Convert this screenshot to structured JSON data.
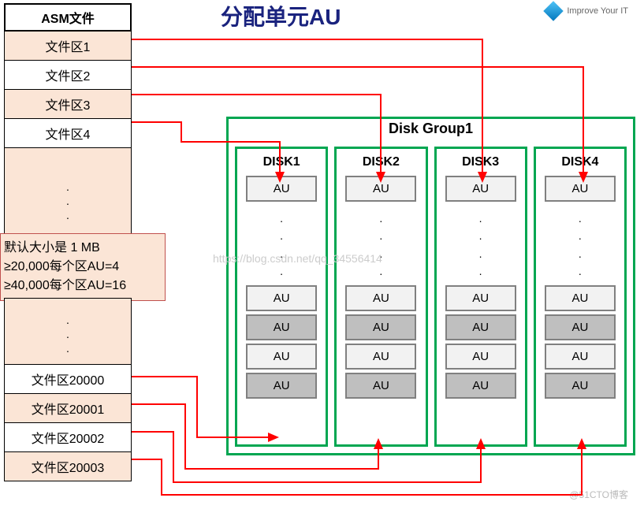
{
  "title": "分配单元AU",
  "logo_text": "Improve Your IT",
  "asm": {
    "header": "ASM文件",
    "cells": [
      {
        "label": "文件区1",
        "white": false
      },
      {
        "label": "文件区2",
        "white": true
      },
      {
        "label": "文件区3",
        "white": false
      },
      {
        "label": "文件区4",
        "white": true
      }
    ],
    "bottom_cells": [
      {
        "label": "文件区20000",
        "white": true
      },
      {
        "label": "文件区20001",
        "white": false
      },
      {
        "label": "文件区20002",
        "white": true
      },
      {
        "label": "文件区20003",
        "white": false
      }
    ]
  },
  "note": {
    "line1": "默认大小是 1 MB",
    "line2": "≥20,000每个区AU=4",
    "line3": "≥40,000每个区AU=16"
  },
  "disk_group": {
    "title": "Disk Group1",
    "disks": [
      {
        "name": "DISK1"
      },
      {
        "name": "DISK2"
      },
      {
        "name": "DISK3"
      },
      {
        "name": "DISK4"
      }
    ],
    "au_label": "AU"
  },
  "watermark": "https://blog.csdn.net/qq_34556414",
  "watermark2": "@51CTO博客",
  "chart_data": {
    "type": "diagram",
    "description": "ASM file extent to AU allocation mapping",
    "mappings": [
      {
        "extent": "文件区1",
        "target_disk": "DISK3",
        "au_index": 0
      },
      {
        "extent": "文件区2",
        "target_disk": "DISK4",
        "au_index": 0
      },
      {
        "extent": "文件区3",
        "target_disk": "DISK2",
        "au_index": 0
      },
      {
        "extent": "文件区4",
        "target_disk": "DISK1",
        "au_index": 0
      },
      {
        "extent": "文件区20000",
        "target_disk": "DISK1",
        "au_group": "bottom"
      },
      {
        "extent": "文件区20001",
        "target_disk": "DISK2",
        "au_group": "bottom"
      },
      {
        "extent": "文件区20002",
        "target_disk": "DISK3",
        "au_group": "bottom"
      },
      {
        "extent": "文件区20003",
        "target_disk": "DISK4",
        "au_group": "bottom"
      }
    ],
    "au_default_size": "1 MB",
    "rules": [
      {
        "threshold": 20000,
        "au_per_extent": 4
      },
      {
        "threshold": 40000,
        "au_per_extent": 16
      }
    ]
  }
}
